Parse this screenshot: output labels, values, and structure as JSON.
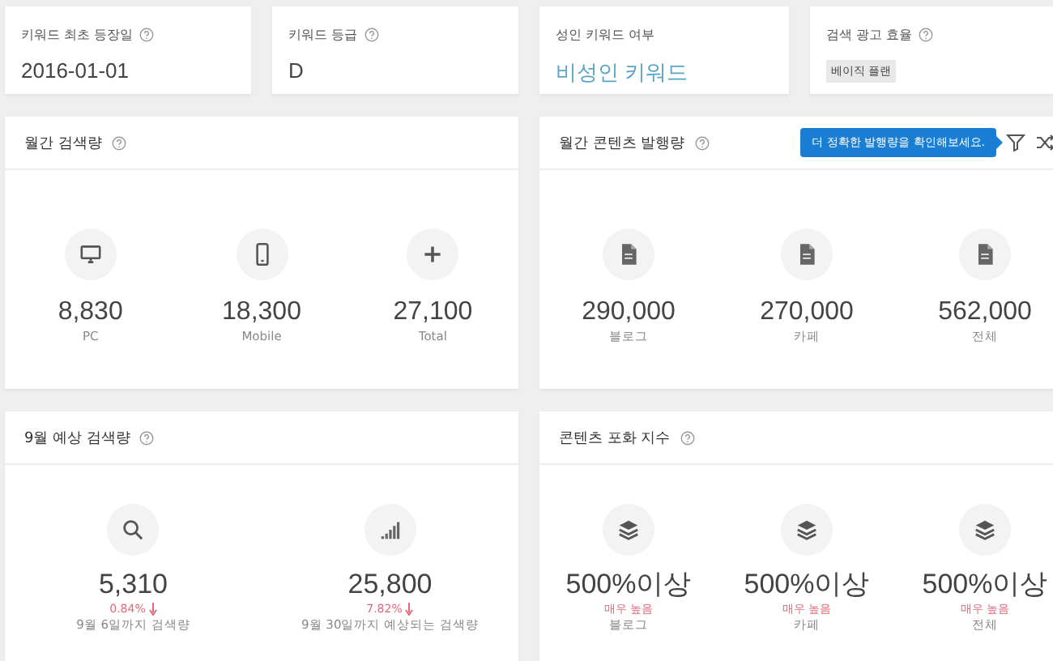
{
  "summary_cards": [
    {
      "label": "키워드 최초 등장일",
      "help": true,
      "kind": "plain",
      "value": "2016-01-01"
    },
    {
      "label": "키워드 등급",
      "help": true,
      "kind": "plain",
      "value": "D"
    },
    {
      "label": "성인 키워드 여부",
      "help": false,
      "kind": "link",
      "value": "비성인 키워드"
    },
    {
      "label": "검색 광고 효율",
      "help": true,
      "kind": "tag",
      "value": "베이직 플랜"
    }
  ],
  "monthly_search": {
    "title": "월간 검색량",
    "help": true,
    "stats": [
      {
        "kind": "monitor",
        "value": "8,830",
        "label": "PC"
      },
      {
        "kind": "phone",
        "value": "18,300",
        "label": "Mobile"
      },
      {
        "kind": "plus",
        "value": "27,100",
        "label": "Total"
      }
    ]
  },
  "monthly_content": {
    "title": "월간 콘텐츠 발행량",
    "help": true,
    "tooltip": "더 정확한 발행량을 확인해보세요.",
    "stats": [
      {
        "kind": "document",
        "value": "290,000",
        "label": "블로그"
      },
      {
        "kind": "document",
        "value": "270,000",
        "label": "카페"
      },
      {
        "kind": "document",
        "value": "562,000",
        "label": "전체"
      }
    ]
  },
  "forecast": {
    "title": "9월 예상 검색량",
    "help": true,
    "stats": [
      {
        "kind": "search",
        "value": "5,310",
        "change": "0.84%",
        "label": "9월 6일까지 검색량"
      },
      {
        "kind": "signal",
        "value": "25,800",
        "change": "7.82%",
        "label": "9월 30일까지 예상되는 검색량"
      }
    ]
  },
  "saturation": {
    "title": "콘텐츠 포화 지수",
    "help": true,
    "stats": [
      {
        "kind": "layers",
        "value": "500%이상",
        "grade": "매우 높음",
        "label": "블로그"
      },
      {
        "kind": "layers",
        "value": "500%이상",
        "grade": "매우 높음",
        "label": "카페"
      },
      {
        "kind": "layers",
        "value": "500%이상",
        "grade": "매우 높음",
        "label": "전체"
      }
    ]
  }
}
